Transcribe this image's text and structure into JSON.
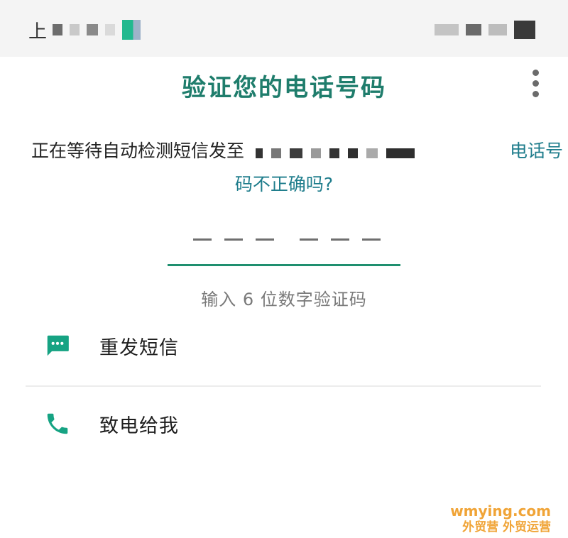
{
  "status_bar": {
    "carrier_label": "上"
  },
  "header": {
    "title": "验证您的电话号码",
    "menu_icon": "more-vert-icon"
  },
  "message": {
    "text": "正在等待自动检测短信发至",
    "phone_number_redacted": true,
    "wrong_number_link_part1": "电话号",
    "wrong_number_link_part2": "码不正确吗?"
  },
  "code_input": {
    "groups": 2,
    "digits_per_group": 3,
    "value": "",
    "accent_color": "#1f8f6f"
  },
  "helper_text": "输入 6 位数字验证码",
  "actions": [
    {
      "label": "重发短信",
      "icon": "sms-icon"
    },
    {
      "label": "致电给我",
      "icon": "phone-icon"
    }
  ],
  "watermark": {
    "domain": "wmying.com",
    "subtitle": "外贸营 外贸运营"
  },
  "colors": {
    "title": "#1f7d6c",
    "link": "#1f7d8c",
    "icon": "#16a383",
    "watermark": "#f0a437"
  }
}
